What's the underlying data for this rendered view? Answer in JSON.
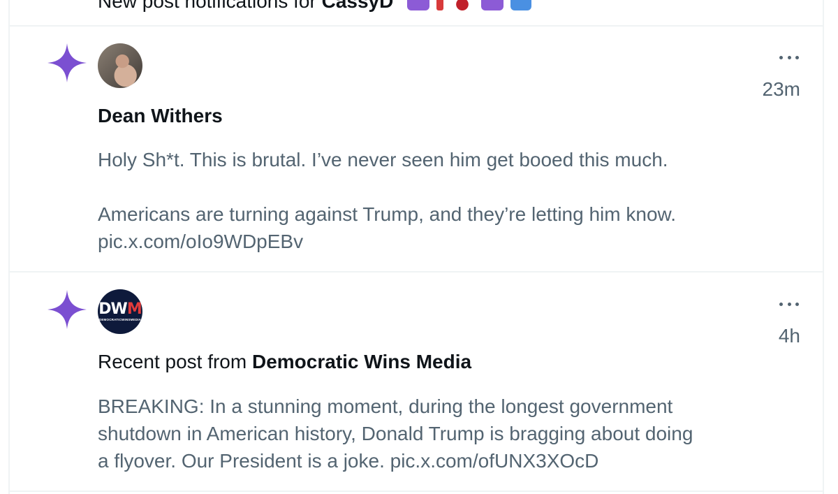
{
  "top_notification": {
    "prefix": "New post notifications for ",
    "name": "CassyD"
  },
  "notifications": [
    {
      "icon": "sparkle-icon",
      "avatar": "avatar-dean-withers",
      "name": "Dean Withers",
      "time": "23m",
      "lines": [
        "Holy Sh*t. This is brutal. I’ve never seen him get booed this much.",
        "Americans are turning against Trump, and they’re letting him know.",
        "pic.x.com/oIo9WDpEBv"
      ]
    },
    {
      "icon": "sparkle-icon",
      "avatar": "avatar-democratic-wins-media",
      "avatar_text": "DWM",
      "avatar_subtext": "DEMOCRATICWINSMEDIA",
      "recent_prefix": "Recent post from ",
      "name": "Democratic Wins Media",
      "time": "4h",
      "lines": [
        "BREAKING: In a stunning moment, during the longest government",
        "shutdown in American history, Donald Trump is bragging about doing",
        "a flyover. Our President is a joke. pic.x.com/ofUNX3XOcD"
      ]
    }
  ],
  "colors": {
    "sparkle": "#7b4fd1",
    "text_primary": "#0f1419",
    "text_secondary": "#536471",
    "divider": "#eff3f4"
  }
}
